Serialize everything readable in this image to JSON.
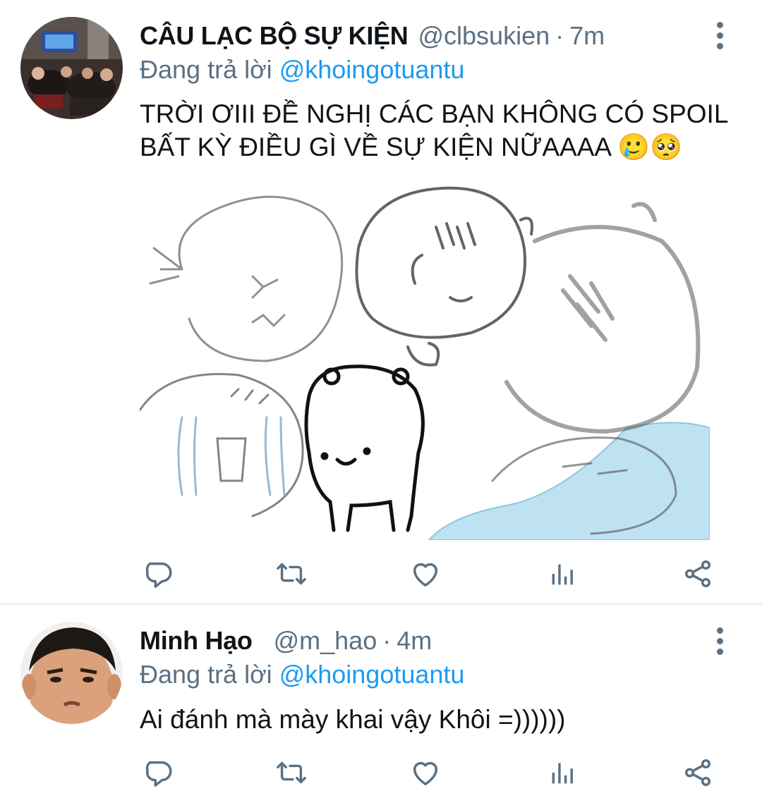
{
  "tweets": [
    {
      "display_name": "CÂU LẠC BỘ SỰ KIỆN",
      "handle": "@clbsukien",
      "separator": "·",
      "time": "7m",
      "reply_prefix": "Đang trả lời",
      "reply_mention": "@khoingotuantu",
      "text": "TRỜI ƠIII ĐỀ NGHỊ CÁC BẠN KHÔNG CÓ SPOIL BẤT KỲ ĐIỀU GÌ VỀ SỰ KIỆN NỮAAAA 🥲🥺"
    },
    {
      "display_name": "Minh Hạo",
      "handle": "@m_hao",
      "separator": "·",
      "time": "4m",
      "reply_prefix": "Đang trả lời",
      "reply_mention": "@khoingotuantu",
      "text": "Ai đánh mà mày khai vậy Khôi =))))))"
    }
  ],
  "icons": {
    "reply": "reply-icon",
    "retweet": "retweet-icon",
    "like": "heart-icon",
    "analytics": "analytics-icon",
    "share": "share-icon",
    "more": "more-options-icon"
  },
  "colors": {
    "text": "#0f1419",
    "secondary": "#5b7083",
    "link": "#1d9bf0",
    "divider": "#e6ecf0"
  }
}
